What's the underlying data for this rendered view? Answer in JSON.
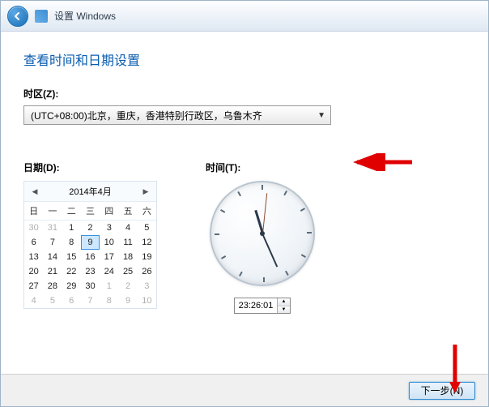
{
  "header": {
    "title": "设置 Windows"
  },
  "page": {
    "title": "查看时间和日期设置"
  },
  "timezone": {
    "label": "时区(Z):",
    "selected": "(UTC+08:00)北京，重庆，香港特别行政区，乌鲁木齐"
  },
  "date": {
    "label": "日期(D):",
    "month_title": "2014年4月",
    "days_of_week": [
      "日",
      "一",
      "二",
      "三",
      "四",
      "五",
      "六"
    ],
    "cells": [
      {
        "n": 30,
        "out": true
      },
      {
        "n": 31,
        "out": true
      },
      {
        "n": 1
      },
      {
        "n": 2
      },
      {
        "n": 3
      },
      {
        "n": 4
      },
      {
        "n": 5
      },
      {
        "n": 6
      },
      {
        "n": 7
      },
      {
        "n": 8
      },
      {
        "n": 9,
        "today": true
      },
      {
        "n": 10
      },
      {
        "n": 11
      },
      {
        "n": 12
      },
      {
        "n": 13
      },
      {
        "n": 14
      },
      {
        "n": 15
      },
      {
        "n": 16
      },
      {
        "n": 17
      },
      {
        "n": 18
      },
      {
        "n": 19
      },
      {
        "n": 20
      },
      {
        "n": 21
      },
      {
        "n": 22
      },
      {
        "n": 23
      },
      {
        "n": 24
      },
      {
        "n": 25
      },
      {
        "n": 26
      },
      {
        "n": 27
      },
      {
        "n": 28
      },
      {
        "n": 29
      },
      {
        "n": 30
      },
      {
        "n": 1,
        "out": true
      },
      {
        "n": 2,
        "out": true
      },
      {
        "n": 3,
        "out": true
      },
      {
        "n": 4,
        "out": true
      },
      {
        "n": 5,
        "out": true
      },
      {
        "n": 6,
        "out": true
      },
      {
        "n": 7,
        "out": true
      },
      {
        "n": 8,
        "out": true
      },
      {
        "n": 9,
        "out": true
      },
      {
        "n": 10,
        "out": true
      }
    ]
  },
  "time": {
    "label": "时间(T):",
    "value": "23:26:01",
    "hours": 23,
    "minutes": 26,
    "seconds": 1
  },
  "footer": {
    "next_label": "下一步(N)"
  }
}
